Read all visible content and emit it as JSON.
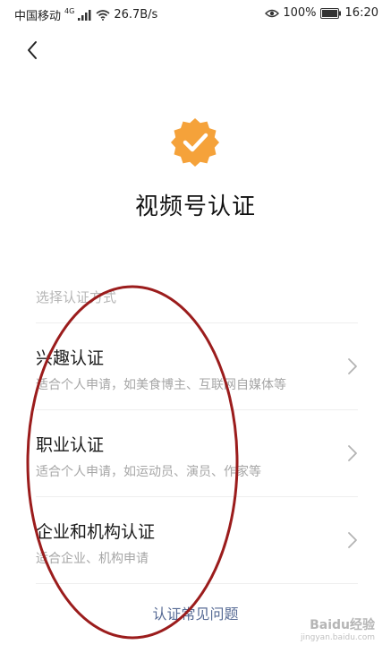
{
  "colors": {
    "accent_badge": "#f5a23a",
    "link": "#576b95",
    "annotation": "#9b1c1c",
    "subtext": "#a6a6a6",
    "label": "#b6b6b6"
  },
  "status_bar": {
    "carrier": "中国移动",
    "network_type": "4G",
    "net_speed": "26.7B/s",
    "battery": "100%",
    "time": "16:20"
  },
  "header": {
    "back_icon": "chevron-left-icon"
  },
  "main": {
    "badge_icon": "verified-badge-icon",
    "title": "视频号认证",
    "section_label": "选择认证方式",
    "options": [
      {
        "title": "兴趣认证",
        "description": "适合个人申请，如美食博主、互联网自媒体等"
      },
      {
        "title": "职业认证",
        "description": "适合个人申请，如运动员、演员、作家等"
      },
      {
        "title": "企业和机构认证",
        "description": "适合企业、机构申请"
      }
    ],
    "faq_link": "认证常见问题"
  },
  "watermark": {
    "main": "Baidu经验",
    "sub": "jingyan.baidu.com"
  }
}
